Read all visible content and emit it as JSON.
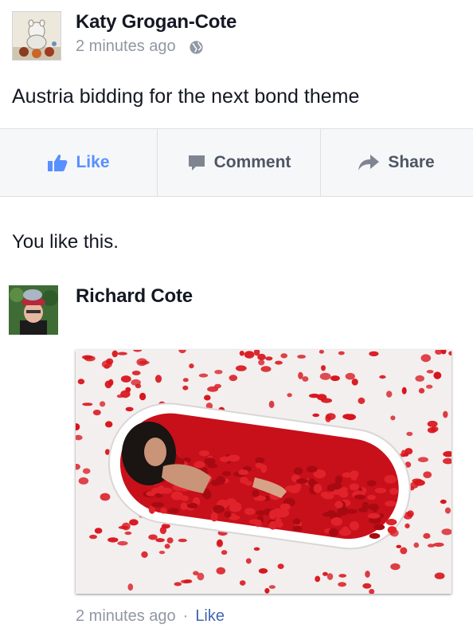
{
  "post": {
    "author": "Katy Grogan-Cote",
    "timestamp": "2 minutes ago",
    "privacy_icon": "globe-icon",
    "text": "Austria bidding for the next bond theme"
  },
  "actions": {
    "like": "Like",
    "comment": "Comment",
    "share": "Share"
  },
  "likes_summary": "You like this.",
  "comment": {
    "author": "Richard Cote",
    "timestamp": "2 minutes ago",
    "separator": "·",
    "like_label": "Like"
  },
  "colors": {
    "like_active": "#5890ff",
    "action_text": "#4e5665",
    "meta_text": "#9197a3",
    "link": "#4267b2",
    "petals": "#d8141c"
  }
}
